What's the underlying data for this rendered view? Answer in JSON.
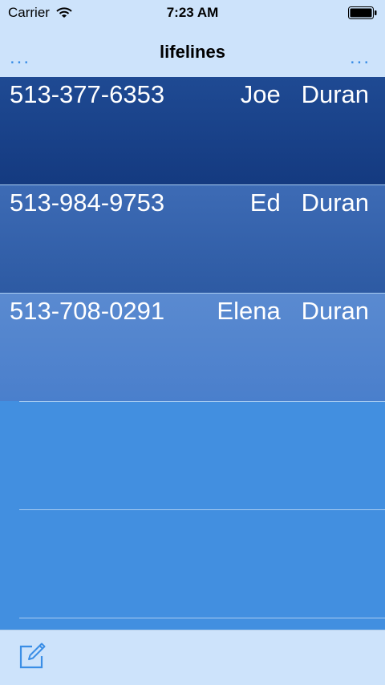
{
  "status_bar": {
    "carrier": "Carrier",
    "time": "7:23 AM"
  },
  "nav": {
    "title": "lifelines",
    "left_button": "...",
    "right_button": "..."
  },
  "contacts": [
    {
      "phone": "513-377-6353",
      "first": "Joe",
      "last": "Duran"
    },
    {
      "phone": "513-984-9753",
      "first": "Ed",
      "last": "Duran"
    },
    {
      "phone": "513-708-0291",
      "first": "Elena",
      "last": "Duran"
    }
  ],
  "colors": {
    "accent": "#3a8ee6",
    "bar_background": "#cde3fb",
    "list_background": "#428fe0",
    "row_1": "#173e84",
    "row_2": "#3563ad",
    "row_3": "#5283cc"
  },
  "icons": {
    "wifi": "wifi-icon",
    "battery": "battery-icon",
    "compose": "compose-icon"
  }
}
